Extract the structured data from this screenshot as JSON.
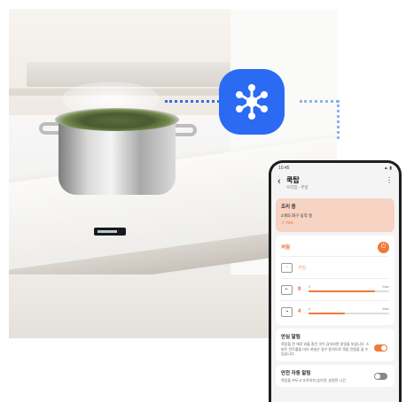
{
  "scene": {
    "brand_color": "#2b6bf3",
    "accent_color": "#f07a3a",
    "badge_icon": "smartthings-icon"
  },
  "phone": {
    "status_time": "10:45",
    "status_icons": "▲ ▮",
    "header": {
      "back_icon": "chevron-left-icon",
      "title": "쿡탑",
      "subtitle": "우리집 - 주방",
      "more_icon": "more-vertical-icon"
    },
    "status_card": {
      "title": "조리 중",
      "line": "2개의 화구 동작 중",
      "progress": "↗ 73%"
    },
    "power": {
      "label": "켜짐",
      "button_icon": "power-icon",
      "button_glyph": "⏻"
    },
    "burners": [
      {
        "value": "꺼짐",
        "min": "",
        "max": "",
        "level": 0,
        "active": false
      },
      {
        "value": "9",
        "min": "0",
        "max": "Max",
        "level": 0.82,
        "active": true
      },
      {
        "value": "4",
        "min": "0",
        "max": "Max",
        "level": 0.45,
        "active": true
      }
    ],
    "safety_alert": {
      "title": "안심 알림",
      "description": "쿡탑을 켠 채로 외출 중인 것이 감지되면 알림을 보냅니다. 스마트 컨트롤을 미리 켜놓은 경우 원격으로 쿡탑 전원을 끌 수 있습니다.",
      "enabled": true
    },
    "auto_safety": {
      "title": "안전 자동 알림",
      "description": "쿡탑을 켜두고 조작하지 않으면, 설정된 시간",
      "enabled": false
    }
  }
}
